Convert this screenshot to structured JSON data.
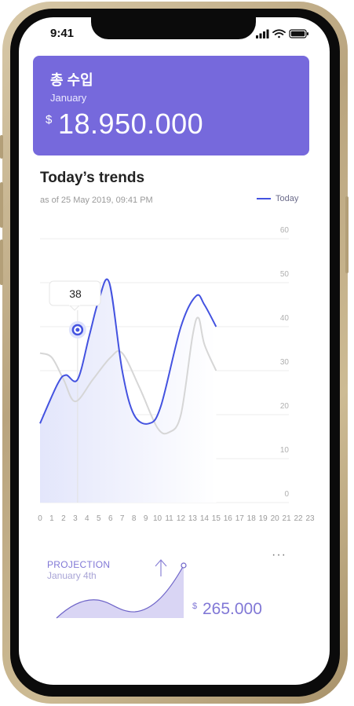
{
  "status_bar": {
    "time": "9:41"
  },
  "card": {
    "title": "총 수입",
    "month": "January",
    "currency": "$",
    "amount": "18.950.000"
  },
  "trends": {
    "title": "Today’s trends",
    "subtitle": "as of 25 May 2019, 09:41 PM",
    "legend_label": "Today",
    "tooltip_value": "38"
  },
  "chart_data": {
    "type": "line",
    "title": "Today’s trends",
    "y_ticks": [
      "60",
      "50",
      "40",
      "30",
      "20",
      "10",
      "0"
    ],
    "x_ticks": [
      "0",
      "1",
      "2",
      "3",
      "4",
      "5",
      "6",
      "7",
      "8",
      "9",
      "10",
      "11",
      "12",
      "13",
      "14",
      "15",
      "16",
      "17",
      "18",
      "19",
      "20",
      "21",
      "22",
      "23"
    ],
    "ylim": [
      0,
      60
    ],
    "xlim": [
      0,
      23
    ],
    "series": [
      {
        "name": "Today",
        "color": "#4352e0",
        "x": [
          0,
          1.5,
          2.2,
          3.2,
          4.2,
          5,
          5.9,
          7,
          8,
          9.3,
          10.3,
          12,
          13.3,
          14,
          15
        ],
        "y": [
          18,
          27,
          29,
          28,
          38,
          46,
          50,
          30,
          20,
          18,
          22,
          40,
          47,
          45,
          40
        ]
      },
      {
        "name": "",
        "color": "#d2d2d2",
        "x": [
          0,
          1,
          2,
          3,
          4.5,
          6,
          7,
          8.5,
          10,
          11,
          12,
          13,
          13.5,
          14,
          15
        ],
        "y": [
          34,
          33,
          28,
          23,
          28,
          33,
          34,
          26,
          17,
          16,
          20,
          38,
          42,
          36,
          30
        ]
      }
    ],
    "annotation": {
      "x": 3.2,
      "y": 28,
      "label": "38"
    },
    "grid": true
  },
  "projection": {
    "label": "PROJECTION",
    "date": "January 4th",
    "currency": "$",
    "amount": "265.000",
    "more_label": "···",
    "color": "#8178d6"
  }
}
